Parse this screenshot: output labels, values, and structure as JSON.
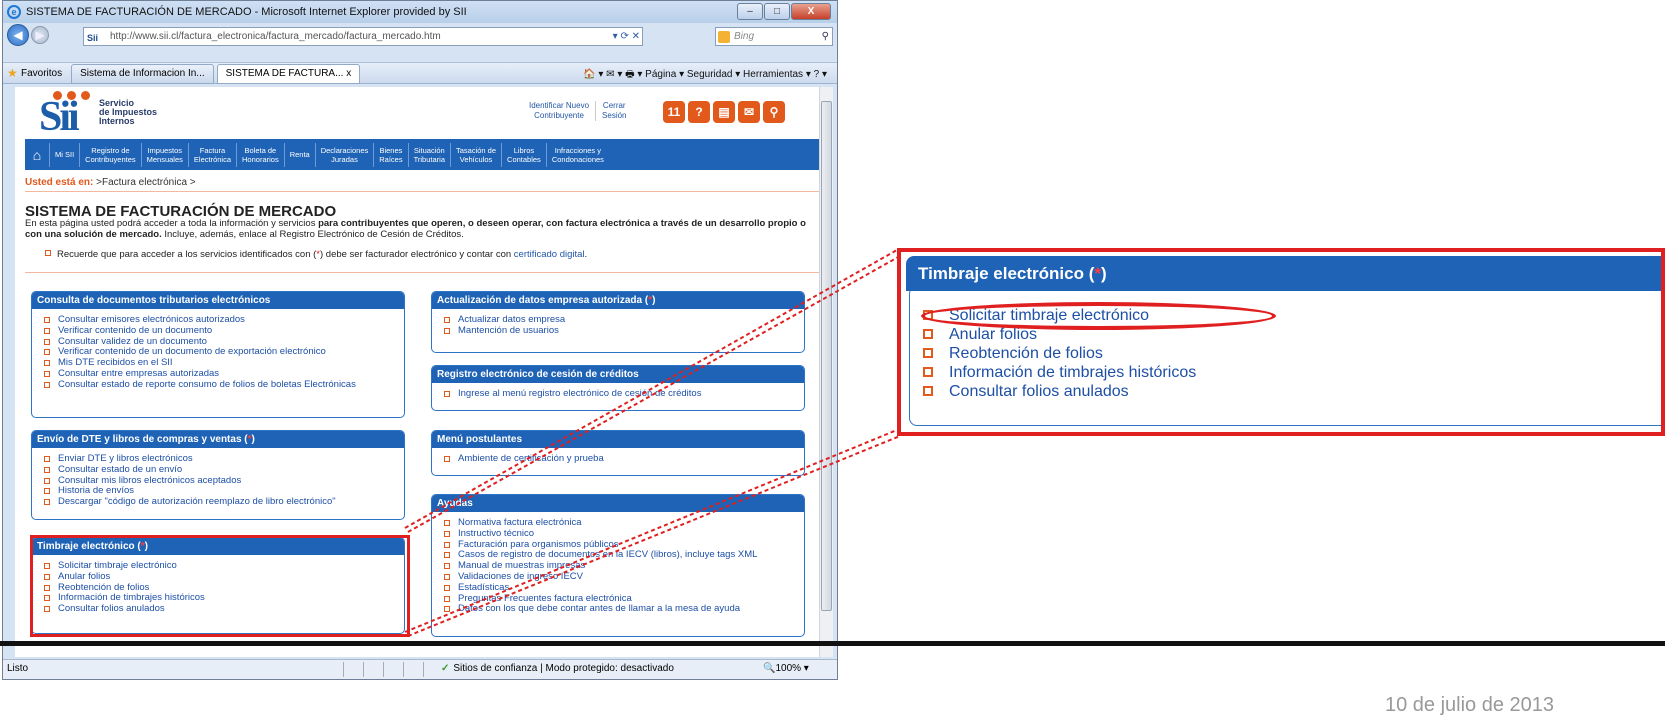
{
  "window": {
    "title": "SISTEMA DE FACTURACIÓN DE MERCADO - Microsoft Internet Explorer provided by SII",
    "min": "–",
    "max": "□",
    "close": "X"
  },
  "address": {
    "logo": "Sii",
    "url": "http://www.sii.cl/factura_electronica/factura_mercado/factura_mercado.htm",
    "tools": "▾ ⟳ ✕",
    "search_placeholder": "Bing",
    "search_icon": "magnifier-icon"
  },
  "favbar": {
    "favoritos": "Favoritos",
    "tab1": "Sistema de Informacion In...",
    "tab2": "SISTEMA DE FACTURA...",
    "tab_close": "x",
    "cmd": "🏠 ▾  ✉ ▾  🖶 ▾  Página ▾  Seguridad ▾  Herramientas ▾  ? ▾"
  },
  "site": {
    "brand": [
      "Servicio",
      "de Impuestos",
      "Internos"
    ],
    "links": [
      {
        "l1": "Identificar Nuevo",
        "l2": "Contribuyente"
      },
      {
        "l1": "Cerrar",
        "l2": "Sesión"
      }
    ],
    "icons": [
      {
        "name": "calendar-icon",
        "glyph": "11",
        "color": "#e2591c"
      },
      {
        "name": "help-icon",
        "glyph": "?",
        "color": "#e2591c"
      },
      {
        "name": "document-icon",
        "glyph": "▤",
        "color": "#e2591c"
      },
      {
        "name": "mail-icon",
        "glyph": "✉",
        "color": "#e2591c"
      },
      {
        "name": "search-icon",
        "glyph": "⚲",
        "color": "#e2591c"
      }
    ],
    "menu": [
      {
        "l1": "Mi SII",
        "l2": ""
      },
      {
        "l1": "Registro de",
        "l2": "Contribuyentes"
      },
      {
        "l1": "Impuestos",
        "l2": "Mensuales"
      },
      {
        "l1": "Factura",
        "l2": "Electrónica"
      },
      {
        "l1": "Boleta de",
        "l2": "Honorarios"
      },
      {
        "l1": "Renta",
        "l2": ""
      },
      {
        "l1": "Declaraciones",
        "l2": "Juradas"
      },
      {
        "l1": "Bienes",
        "l2": "Raíces"
      },
      {
        "l1": "Situación",
        "l2": "Tributaria"
      },
      {
        "l1": "Tasación de",
        "l2": "Vehículos"
      },
      {
        "l1": "Libros",
        "l2": "Contables"
      },
      {
        "l1": "Infracciones y",
        "l2": "Condonaciones"
      }
    ],
    "crumb_label": "Usted está en:",
    "crumb_path": " >Factura electrónica >",
    "title": "SISTEMA DE FACTURACIÓN DE MERCADO",
    "intro_a": "En esta página usted podrá acceder a toda la información y servicios ",
    "intro_b": "para contribuyentes que operen, o deseen operar, con factura electrónica a través de un desarrollo propio o con una solución de mercado.",
    "intro_c": " Incluye, además, enlace al Registro Electrónico de Cesión de Créditos.",
    "note_a": "Recuerde que para acceder a los servicios identificados con (",
    "note_star": "*",
    "note_b": ") debe ser facturador electrónico y contar con ",
    "note_link": "certificado digital",
    "note_c": ".",
    "boxes": [
      {
        "title": "Consulta de documentos tributarios electrónicos",
        "star": "",
        "items": [
          "Consultar emisores electrónicos autorizados",
          "Verificar contenido de un documento",
          "Consultar validez de un documento",
          "Verificar contenido de un documento de exportación electrónico",
          "Mis DTE recibidos en el SII",
          "Consultar entre empresas autorizadas",
          "Consultar estado de reporte consumo de folios de boletas Electrónicas"
        ]
      },
      {
        "title": "Actualización de datos empresa autorizada (",
        "star": "*",
        "items": [
          "Actualizar datos empresa",
          "Mantención de usuarios"
        ]
      },
      {
        "title": "Registro electrónico de cesión de créditos",
        "star": "",
        "items": [
          "Ingrese al menú registro electrónico de cesión de créditos"
        ]
      },
      {
        "title": "Envío de DTE y libros de compras y ventas (",
        "star": "*",
        "items": [
          "Enviar DTE y libros electrónicos",
          "Consultar estado de un envío",
          "Consultar mis libros electrónicos aceptados",
          "Historia de envíos",
          "Descargar \"código de autorización reemplazo de libro electrónico\""
        ]
      },
      {
        "title": "Menú postulantes",
        "star": "",
        "items": [
          "Ambiente de certificación y prueba"
        ]
      },
      {
        "title": "Ayudas",
        "star": "",
        "items": [
          "Normativa factura electrónica",
          "Instructivo técnico",
          "Facturación para organismos públicos",
          "Casos de registro de documentos en la IECV (libros), incluye tags XML",
          "Manual de muestras impresas",
          "Validaciones de ingreso IECV",
          "Estadísticas",
          "Preguntas Frecuentes factura electrónica",
          "Datos con los que debe contar antes de llamar a la mesa de ayuda"
        ]
      },
      {
        "title": "Timbraje electrónico (",
        "star": "*",
        "items": [
          "Solicitar timbraje electrónico",
          "Anular folios",
          "Reobtención de folios",
          "Información de timbrajes históricos",
          "Consultar folios anulados"
        ]
      }
    ],
    "close_paren": ")"
  },
  "status": {
    "left": "Listo",
    "trust": "Sitios de confianza | Modo protegido: desactivado",
    "zoom": "🔍100%  ▾"
  },
  "zoom": {
    "title": "Timbraje electrónico (",
    "star": "*",
    "close": ")",
    "items": [
      "Solicitar timbraje electrónico",
      "Anular folios",
      "Reobtención de folios",
      "Información de timbrajes históricos",
      "Consultar folios anulados"
    ]
  },
  "date": "10 de julio de 2013",
  "colors": {
    "sii_blue": "#1f63b6",
    "accent_orange": "#e2591c",
    "highlight_red": "#e02020"
  }
}
